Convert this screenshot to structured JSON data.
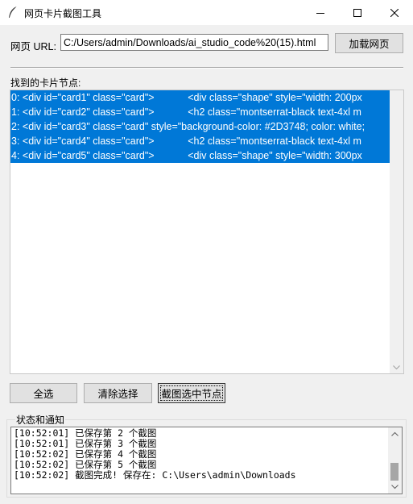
{
  "window": {
    "title": "网页卡片截图工具",
    "icon": "feather-icon"
  },
  "url_bar": {
    "label": "网页 URL:",
    "value": "C:/Users/admin/Downloads/ai_studio_code%20(15).html",
    "load_button": "加载网页"
  },
  "card_list": {
    "label": "找到的卡片节点:",
    "items": [
      "0: <div id=\"card1\" class=\"card\">            <div class=\"shape\" style=\"width: 200px",
      "1: <div id=\"card2\" class=\"card\">            <h2 class=\"montserrat-black text-4xl m",
      "2: <div id=\"card3\" class=\"card\" style=\"background-color: #2D3748; color: white;",
      "3: <div id=\"card4\" class=\"card\">            <h2 class=\"montserrat-black text-4xl m",
      "4: <div id=\"card5\" class=\"card\">            <div class=\"shape\" style=\"width: 300px"
    ],
    "all_selected": true
  },
  "actions": {
    "select_all": "全选",
    "clear_selection": "清除选择",
    "screenshot_selected": "截图选中节点"
  },
  "status": {
    "legend": "状态和通知",
    "lines": [
      "[10:52:01] 已保存第 2 个截图",
      "[10:52:01] 已保存第 3 个截图",
      "[10:52:02] 已保存第 4 个截图",
      "[10:52:02] 已保存第 5 个截图",
      "[10:52:02] 截图完成! 保存在: C:\\Users\\admin\\Downloads"
    ]
  },
  "colors": {
    "selection": "#0078d7",
    "window_bg": "#f0f0f0"
  }
}
